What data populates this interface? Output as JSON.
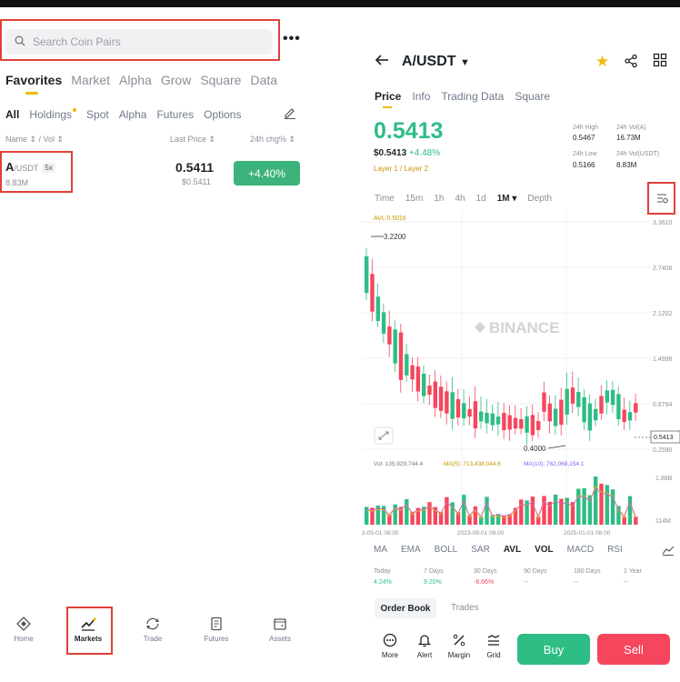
{
  "search": {
    "placeholder": "Search Coin Pairs"
  },
  "more_label": "•••",
  "main_tabs": [
    "Favorites",
    "Market",
    "Alpha",
    "Grow",
    "Square",
    "Data"
  ],
  "sub_tabs": [
    "All",
    "Holdings",
    "Spot",
    "Alpha",
    "Futures",
    "Options"
  ],
  "list_header": {
    "name": "Name ⇕ / Vol ⇕",
    "last": "Last Price ⇕",
    "chg": "24h chg% ⇕"
  },
  "coin": {
    "base": "A",
    "quote": "/USDT",
    "leverage": "5x",
    "vol": "8.83M",
    "price": "0.5411",
    "price_usd": "$0.5411",
    "change": "+4.40%"
  },
  "bottom_nav": [
    "Home",
    "Markets",
    "Trade",
    "Futures",
    "Assets"
  ],
  "detail": {
    "pair": "A/USDT",
    "tabs": [
      "Price",
      "Info",
      "Trading Data",
      "Square"
    ],
    "price": "0.5413",
    "price_usd": "$0.5413",
    "change": "+4.48%",
    "layer": "Layer 1 / Layer 2",
    "stats": {
      "high_label": "24h High",
      "high": "0.5467",
      "vola_label": "24h Vol(A)",
      "vola": "16.73M",
      "low_label": "24h Low",
      "low": "0.5166",
      "volu_label": "24h Vol(USDT)",
      "volu": "8.83M"
    },
    "time_tabs": [
      "Time",
      "15m",
      "1h",
      "4h",
      "1d",
      "1M ▾",
      "Depth"
    ],
    "chart_labels": {
      "avl": "AVL 0.5016",
      "high_marker": "3.2200",
      "low_marker": "0.4000",
      "watermark": "BINANCE",
      "current": "0.5413",
      "y_ticks": [
        "3.3610",
        "2.7406",
        "2.1202",
        "1.4998",
        "0.8794",
        "0.2590"
      ],
      "vol_line": "Vol: 135,929,744.4",
      "ma5": "MA(5): 713,438,044.6",
      "ma10": "MA(10): 762,068,154.1",
      "vol_ticks": [
        "1.86B",
        "114M"
      ],
      "x_ticks": [
        "2-05-01 08:00",
        "2023-09-01 08:00",
        "2025-01-01 08:00"
      ]
    },
    "indicators": [
      "MA",
      "EMA",
      "BOLL",
      "SAR",
      "AVL",
      "VOL",
      "MACD",
      "RSI"
    ],
    "performance": [
      {
        "label": "Today",
        "value": "4.24%",
        "color": "#2ebd85"
      },
      {
        "label": "7 Days",
        "value": "9.20%",
        "color": "#2ebd85"
      },
      {
        "label": "30 Days",
        "value": "-8.66%",
        "color": "#f6465d"
      },
      {
        "label": "90 Days",
        "value": "--",
        "color": "#8a8f98"
      },
      {
        "label": "180 Days",
        "value": "--",
        "color": "#8a8f98"
      },
      {
        "label": "1 Year",
        "value": "--",
        "color": "#8a8f98"
      }
    ],
    "order_book": "Order Book",
    "trades": "Trades",
    "actions": [
      "More",
      "Alert",
      "Margin",
      "Grid"
    ],
    "buy": "Buy",
    "sell": "Sell"
  },
  "colors": {
    "up": "#2ebd85",
    "down": "#f6465d",
    "accent": "#f0b90b",
    "highlight": "#e0403a"
  }
}
